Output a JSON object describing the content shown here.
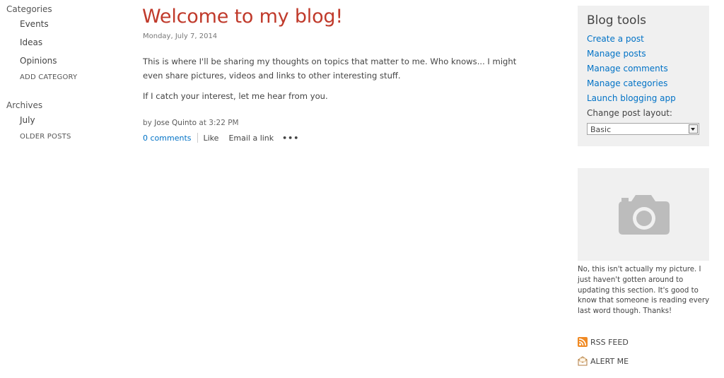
{
  "left_nav": {
    "categories_heading": "Categories",
    "categories": [
      "Events",
      "Ideas",
      "Opinions"
    ],
    "add_category": "ADD CATEGORY",
    "archives_heading": "Archives",
    "archives": [
      "July"
    ],
    "older_posts": "OLDER POSTS"
  },
  "post": {
    "title": "Welcome to my blog!",
    "date": "Monday, July 7, 2014",
    "paragraphs": [
      "This is where I'll be sharing my thoughts on topics that matter to me. Who knows... I might even share pictures, videos and links to other interesting stuff.",
      "If I catch your interest, let me hear from you."
    ],
    "byline_prefix": "by",
    "author": "Jose Quinto",
    "byline_at": "at 3:22 PM",
    "comments": "0 comments",
    "like": "Like",
    "email_link": "Email a link",
    "more": "•••"
  },
  "blog_tools": {
    "title": "Blog tools",
    "links": [
      "Create a post",
      "Manage posts",
      "Manage comments",
      "Manage categories",
      "Launch blogging app"
    ],
    "layout_label": "Change post layout:",
    "layout_value": "Basic"
  },
  "picture": {
    "icon": "camera-icon",
    "caption": "No, this isn't actually my picture. I just haven't gotten around to updating this section. It's good to know that someone is reading every last word though. Thanks!"
  },
  "feeds": {
    "rss_label": "RSS FEED",
    "rss_icon": "rss-icon",
    "alert_label": "ALERT ME",
    "alert_icon": "alert-icon"
  },
  "colors": {
    "title_red": "#c03a2b",
    "link_blue": "#0072c6",
    "panel_gray": "#f0f0f0",
    "rss_orange": "#f08a24"
  }
}
